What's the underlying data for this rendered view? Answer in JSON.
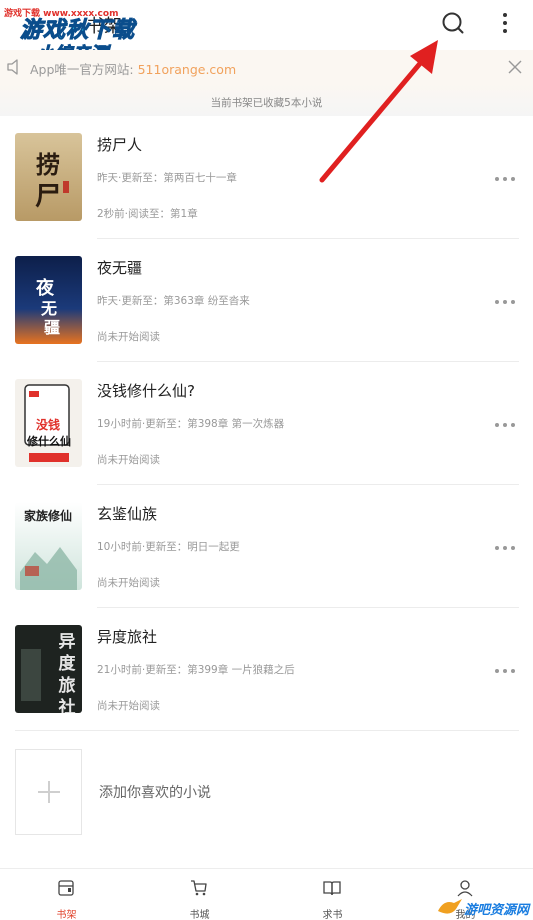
{
  "header": {
    "tab_partial": "书架",
    "search_icon": "search-icon",
    "more_icon": "more-vertical-icon",
    "watermark_small": "游戏下载 www.xxxx.com",
    "watermark_main": "游戏秋下载",
    "watermark_sub": "小编亲测"
  },
  "notice": {
    "icon": "speaker-icon",
    "prefix": "App唯一官方网站: ",
    "link": "511orange.com",
    "close_icon": "close-icon",
    "link_color": "#f1a25d"
  },
  "shelf": {
    "count_text": "当前书架已收藏5本小说"
  },
  "books": [
    {
      "title": "捞尸人",
      "update": "昨天·更新至：第两百七十一章",
      "progress": "2秒前·阅读至：第1章",
      "cover_text": "捞尸人"
    },
    {
      "title": "夜无疆",
      "update": "昨天·更新至：第363章 纷至沓来",
      "progress": "尚未开始阅读",
      "cover_text": "夜无疆"
    },
    {
      "title": "没钱修什么仙?",
      "update": "19小时前·更新至：第398章 第一次炼器",
      "progress": "尚未开始阅读",
      "cover_text": "没钱修什么仙?"
    },
    {
      "title": "玄鉴仙族",
      "update": "10小时前·更新至：明日一起更",
      "progress": "尚未开始阅读",
      "cover_text": "家族修仙"
    },
    {
      "title": "异度旅社",
      "update": "21小时前·更新至：第399章 一片狼藉之后",
      "progress": "尚未开始阅读",
      "cover_text": "异度旅社"
    }
  ],
  "add": {
    "label": "添加你喜欢的小说",
    "icon": "plus-icon"
  },
  "nav": {
    "items": [
      {
        "label": "书架",
        "icon": "bookshelf-icon",
        "active": true
      },
      {
        "label": "书城",
        "icon": "cart-icon",
        "active": false
      },
      {
        "label": "求书",
        "icon": "book-icon",
        "active": false
      },
      {
        "label": "我的",
        "icon": "user-icon",
        "active": false
      }
    ],
    "active_color": "#e0422b"
  },
  "watermark_br": "游吧资源网"
}
